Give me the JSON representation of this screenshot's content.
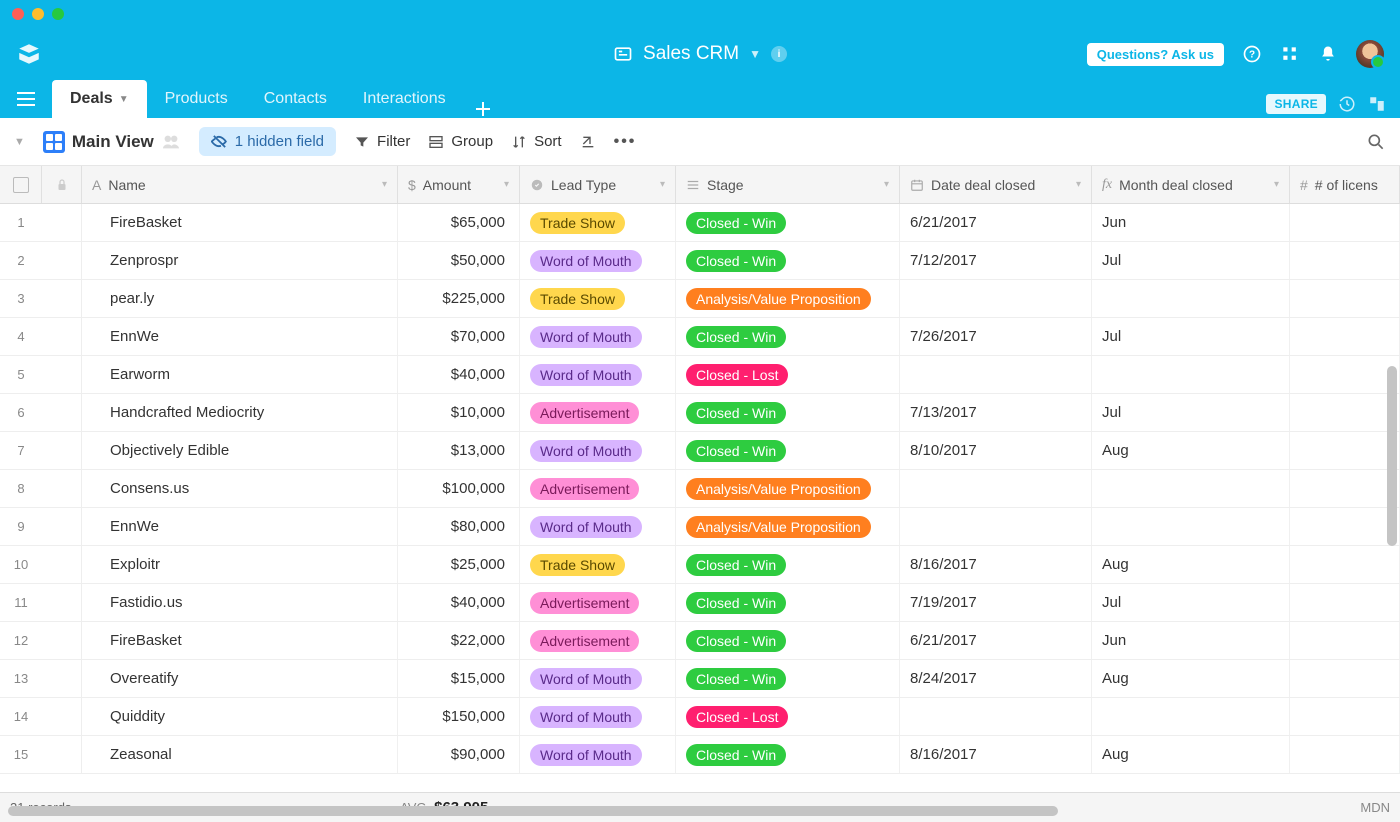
{
  "app": {
    "title": "Sales CRM",
    "ask_button": "Questions? Ask us"
  },
  "tabs": [
    {
      "label": "Deals",
      "active": true
    },
    {
      "label": "Products",
      "active": false
    },
    {
      "label": "Contacts",
      "active": false
    },
    {
      "label": "Interactions",
      "active": false
    }
  ],
  "share_label": "SHARE",
  "view": {
    "name": "Main View",
    "hidden_fields": "1 hidden field",
    "filter": "Filter",
    "group": "Group",
    "sort": "Sort"
  },
  "columns": {
    "name": "Name",
    "amount": "Amount",
    "lead": "Lead Type",
    "stage": "Stage",
    "date": "Date deal closed",
    "month": "Month deal closed",
    "licenses": "# of licens"
  },
  "rows": [
    {
      "n": 1,
      "name": "FireBasket",
      "amount": "$65,000",
      "lead": "Trade Show",
      "lead_k": "trade",
      "stage": "Closed - Win",
      "stage_k": "win",
      "date": "6/21/2017",
      "month": "Jun"
    },
    {
      "n": 2,
      "name": "Zenprospr",
      "amount": "$50,000",
      "lead": "Word of Mouth",
      "lead_k": "wom",
      "stage": "Closed - Win",
      "stage_k": "win",
      "date": "7/12/2017",
      "month": "Jul"
    },
    {
      "n": 3,
      "name": "pear.ly",
      "amount": "$225,000",
      "lead": "Trade Show",
      "lead_k": "trade",
      "stage": "Analysis/Value Proposition",
      "stage_k": "avp",
      "date": "",
      "month": ""
    },
    {
      "n": 4,
      "name": "EnnWe",
      "amount": "$70,000",
      "lead": "Word of Mouth",
      "lead_k": "wom",
      "stage": "Closed - Win",
      "stage_k": "win",
      "date": "7/26/2017",
      "month": "Jul"
    },
    {
      "n": 5,
      "name": "Earworm",
      "amount": "$40,000",
      "lead": "Word of Mouth",
      "lead_k": "wom",
      "stage": "Closed - Lost",
      "stage_k": "lost",
      "date": "",
      "month": ""
    },
    {
      "n": 6,
      "name": "Handcrafted Mediocrity",
      "amount": "$10,000",
      "lead": "Advertisement",
      "lead_k": "adv",
      "stage": "Closed - Win",
      "stage_k": "win",
      "date": "7/13/2017",
      "month": "Jul"
    },
    {
      "n": 7,
      "name": "Objectively Edible",
      "amount": "$13,000",
      "lead": "Word of Mouth",
      "lead_k": "wom",
      "stage": "Closed - Win",
      "stage_k": "win",
      "date": "8/10/2017",
      "month": "Aug"
    },
    {
      "n": 8,
      "name": "Consens.us",
      "amount": "$100,000",
      "lead": "Advertisement",
      "lead_k": "adv",
      "stage": "Analysis/Value Proposition",
      "stage_k": "avp",
      "date": "",
      "month": ""
    },
    {
      "n": 9,
      "name": "EnnWe",
      "amount": "$80,000",
      "lead": "Word of Mouth",
      "lead_k": "wom",
      "stage": "Analysis/Value Proposition",
      "stage_k": "avp",
      "date": "",
      "month": ""
    },
    {
      "n": 10,
      "name": "Exploitr",
      "amount": "$25,000",
      "lead": "Trade Show",
      "lead_k": "trade",
      "stage": "Closed - Win",
      "stage_k": "win",
      "date": "8/16/2017",
      "month": "Aug"
    },
    {
      "n": 11,
      "name": "Fastidio.us",
      "amount": "$40,000",
      "lead": "Advertisement",
      "lead_k": "adv",
      "stage": "Closed - Win",
      "stage_k": "win",
      "date": "7/19/2017",
      "month": "Jul"
    },
    {
      "n": 12,
      "name": "FireBasket",
      "amount": "$22,000",
      "lead": "Advertisement",
      "lead_k": "adv",
      "stage": "Closed - Win",
      "stage_k": "win",
      "date": "6/21/2017",
      "month": "Jun"
    },
    {
      "n": 13,
      "name": "Overeatify",
      "amount": "$15,000",
      "lead": "Word of Mouth",
      "lead_k": "wom",
      "stage": "Closed - Win",
      "stage_k": "win",
      "date": "8/24/2017",
      "month": "Aug"
    },
    {
      "n": 14,
      "name": "Quiddity",
      "amount": "$150,000",
      "lead": "Word of Mouth",
      "lead_k": "wom",
      "stage": "Closed - Lost",
      "stage_k": "lost",
      "date": "",
      "month": ""
    },
    {
      "n": 15,
      "name": "Zeasonal",
      "amount": "$90,000",
      "lead": "Word of Mouth",
      "lead_k": "wom",
      "stage": "Closed - Win",
      "stage_k": "win",
      "date": "8/16/2017",
      "month": "Aug"
    }
  ],
  "footer": {
    "records": "21 records",
    "avg_label": "AVG",
    "avg_value": "$63,905",
    "mdn": "MDN"
  }
}
